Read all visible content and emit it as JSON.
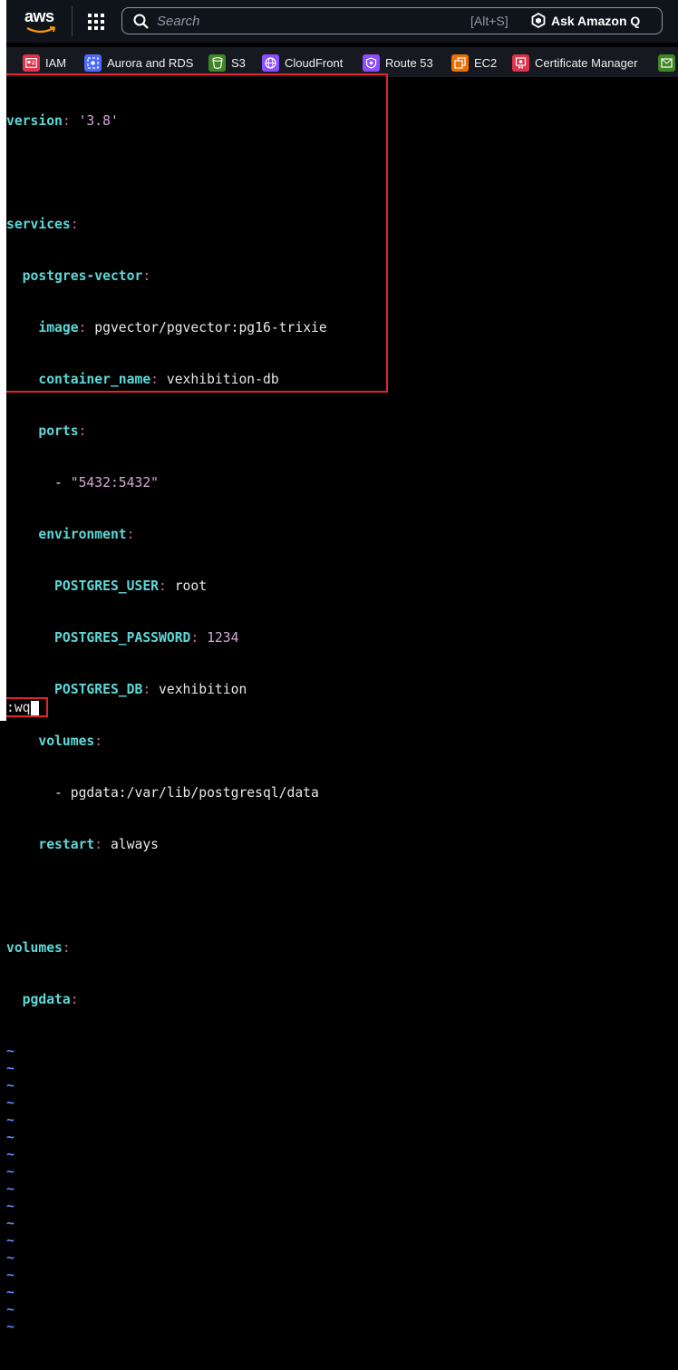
{
  "topbar": {
    "logo_text": "aws",
    "search": {
      "placeholder": "Search",
      "shortcut": "[Alt+S]"
    },
    "ask_q_label": "Ask Amazon Q"
  },
  "favorites": [
    {
      "label": "IAM",
      "color": "#dd344c"
    },
    {
      "label": "Aurora and RDS",
      "color": "#4d6bfe"
    },
    {
      "label": "S3",
      "color": "#3f8624"
    },
    {
      "label": "CloudFront",
      "color": "#8c4fff"
    },
    {
      "label": "Route 53",
      "color": "#8c4fff"
    },
    {
      "label": "EC2",
      "color": "#ed7100"
    },
    {
      "label": "Certificate Manager",
      "color": "#dd344c"
    }
  ],
  "editor": {
    "lines": [
      [
        "version",
        ": ",
        "'3.8'"
      ],
      [],
      [
        "services",
        ":"
      ],
      [
        "  postgres-vector",
        ":"
      ],
      [
        "    image",
        ": ",
        "pgvector/pgvector:pg16-trixie"
      ],
      [
        "    container_name",
        ": ",
        "vexhibition-db"
      ],
      [
        "    ports",
        ":"
      ],
      [
        "      - ",
        "\"5432:5432\""
      ],
      [
        "    environment",
        ":"
      ],
      [
        "      POSTGRES_USER",
        ": ",
        "root"
      ],
      [
        "      POSTGRES_PASSWORD",
        ": ",
        "1234"
      ],
      [
        "      POSTGRES_DB",
        ": ",
        "vexhibition"
      ],
      [
        "    volumes",
        ":"
      ],
      [
        "      - ",
        "pgdata:/var/lib/postgresql/data"
      ],
      [
        "    restart",
        ": ",
        "always"
      ],
      [],
      [
        "volumes",
        ":"
      ],
      [
        "  pgdata",
        ":"
      ]
    ],
    "tilde_char": "~",
    "tilde_count": 17,
    "command": ":wq"
  },
  "colors": {
    "key": "#5fd7d7",
    "punct": "#cc6699",
    "string": "#d7a8d7",
    "tilde": "#5f87ff",
    "highlight": "#e0252c"
  }
}
